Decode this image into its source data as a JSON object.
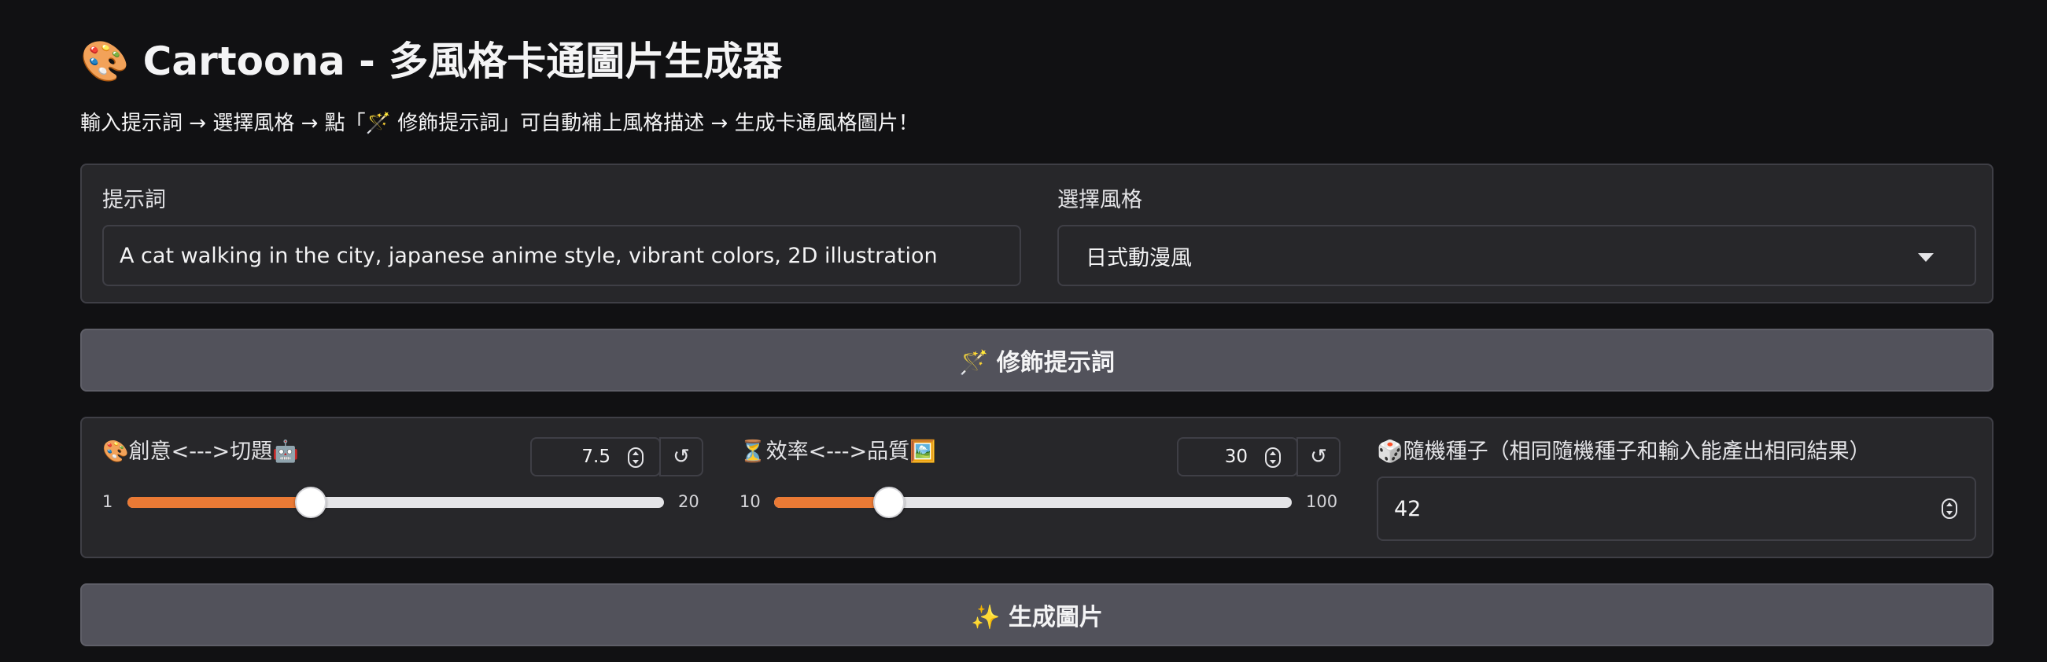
{
  "header": {
    "title": "🎨 Cartoona - 多風格卡通圖片生成器",
    "subtitle": "輸入提示詞 → 選擇風格 → 點「🪄 修飾提示詞」可自動補上風格描述 → 生成卡通風格圖片！"
  },
  "prompt": {
    "label": "提示詞",
    "value": "A cat walking in the city, japanese anime style, vibrant colors, 2D illustration"
  },
  "style": {
    "label": "選擇風格",
    "selected": "日式動漫風"
  },
  "refine_button": {
    "label": "🪄 修飾提示詞"
  },
  "creativity": {
    "label": "🎨創意<--->切題🤖",
    "value": "7.5",
    "min": "1",
    "max": "20",
    "level": 7.5,
    "reset_icon": "↺"
  },
  "steps": {
    "label": "⏳效率<--->品質🖼️",
    "value": "30",
    "min": "10",
    "max": "100",
    "level": 30,
    "reset_icon": "↺"
  },
  "seed": {
    "label": "🎲隨機種子（相同隨機種子和輸入能產出相同結果）",
    "value": "42"
  },
  "generate_button": {
    "label": "✨ 生成圖片"
  },
  "colors": {
    "accent": "#ea7a35",
    "panel": "#27272a",
    "button": "#52525b"
  }
}
